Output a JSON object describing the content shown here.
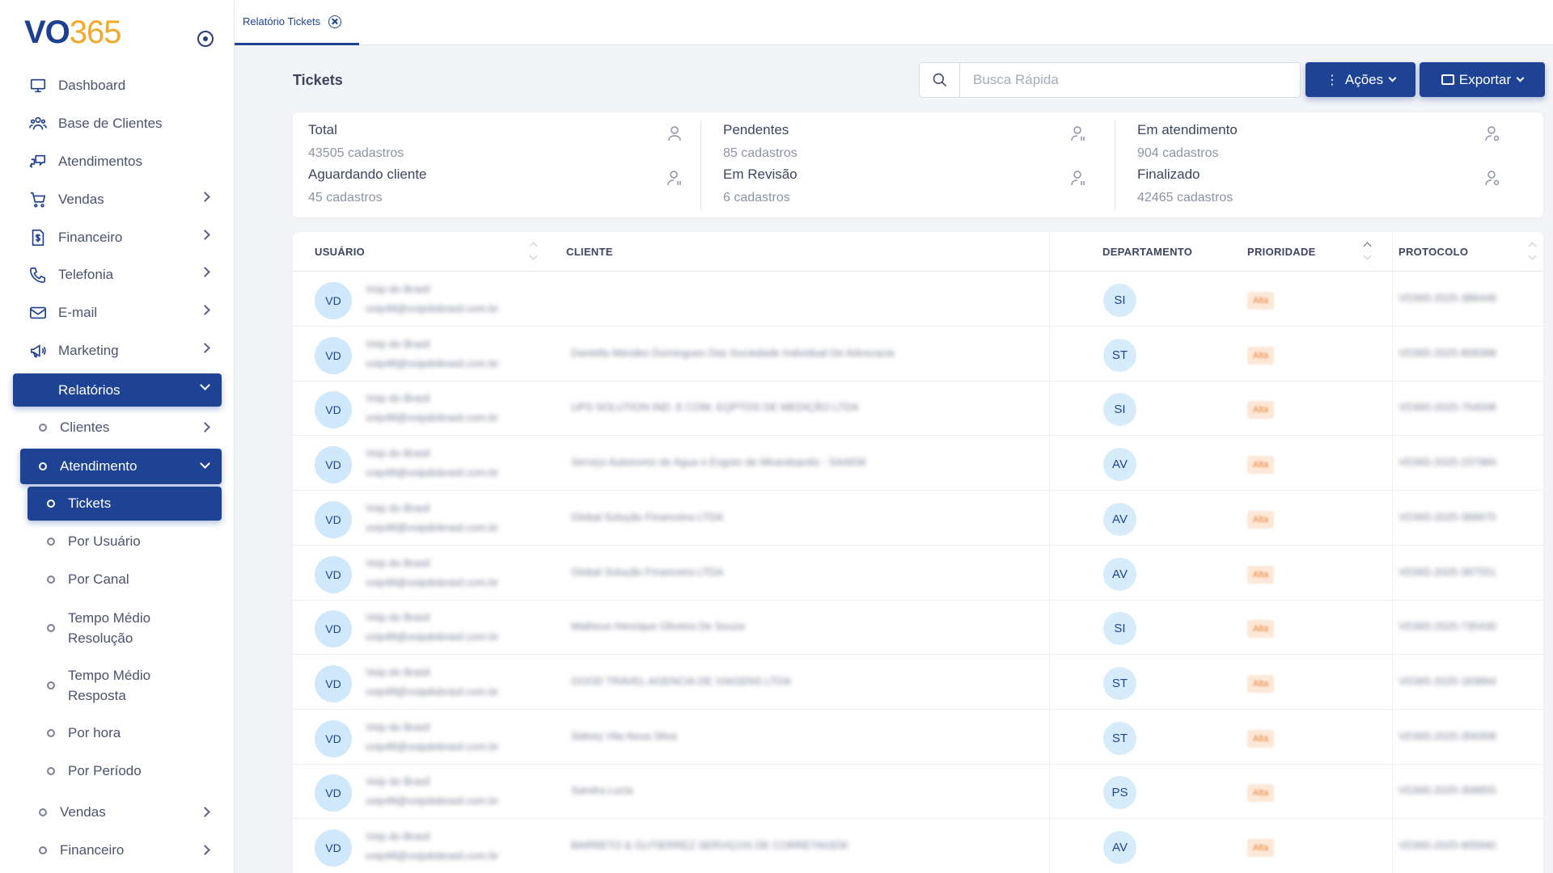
{
  "brand": {
    "logo_a": "VO",
    "logo_b": "365"
  },
  "tab": {
    "label": "Relatório Tickets"
  },
  "sidebar": {
    "items": [
      {
        "label": "Dashboard",
        "icon": "monitor-icon"
      },
      {
        "label": "Base de Clientes",
        "icon": "users-icon"
      },
      {
        "label": "Atendimentos",
        "icon": "chat-icon"
      },
      {
        "label": "Vendas",
        "icon": "cart-icon"
      },
      {
        "label": "Financeiro",
        "icon": "dollar-doc-icon"
      },
      {
        "label": "Telefonia",
        "icon": "phone-icon"
      },
      {
        "label": "E-mail",
        "icon": "mail-icon"
      },
      {
        "label": "Marketing",
        "icon": "megaphone-icon"
      },
      {
        "label": "Relatórios",
        "icon": "none"
      }
    ],
    "sub_items": [
      {
        "label": "Clientes"
      },
      {
        "label": "Atendimento"
      },
      {
        "label": "Tickets"
      },
      {
        "label": "Por Usuário"
      },
      {
        "label": "Por Canal"
      },
      {
        "label": "Tempo Médio Resolução"
      },
      {
        "label": "Tempo Médio Resposta"
      },
      {
        "label": "Por hora"
      },
      {
        "label": "Por Período"
      },
      {
        "label": "Vendas"
      },
      {
        "label": "Financeiro"
      }
    ]
  },
  "header": {
    "title": "Tickets",
    "search_placeholder": "Busca Rápida",
    "acoes_label": "Ações",
    "exportar_label": "Exportar"
  },
  "stats": [
    {
      "label": "Total",
      "value": "43505 cadastros"
    },
    {
      "label": "Pendentes",
      "value": "85 cadastros"
    },
    {
      "label": "Em atendimento",
      "value": "904 cadastros"
    },
    {
      "label": "Aguardando cliente",
      "value": "45 cadastros"
    },
    {
      "label": "Em Revisão",
      "value": "6 cadastros"
    },
    {
      "label": "Finalizado",
      "value": "42465 cadastros"
    }
  ],
  "table": {
    "columns": [
      "USUÁRIO",
      "CLIENTE",
      "DEPARTAMENTO",
      "PRIORIDADE",
      "PROTOCOLO"
    ],
    "rows": [
      {
        "avatar": "VD",
        "user": "Voip do Brasil",
        "email": "voip48@voipdobrasil.com.br",
        "client": "",
        "dept": "SI",
        "priority": "Alta",
        "protocol": "VD365-2025-386448"
      },
      {
        "avatar": "VD",
        "user": "Voip do Brasil",
        "email": "voip48@voipdobrasil.com.br",
        "client": "Daniella Mendes Domingues Das Sociedade Individual De Advocacia",
        "dept": "ST",
        "priority": "Alta",
        "protocol": "VD365-2025-858398"
      },
      {
        "avatar": "VD",
        "user": "Voip do Brasil",
        "email": "voip48@voipdobrasil.com.br",
        "client": "UPS SOLUTION IND. E COM. EQPTOS DE MEDIÇÃO LTDA",
        "dept": "SI",
        "priority": "Alta",
        "protocol": "VD365-2025-754508"
      },
      {
        "avatar": "VD",
        "user": "Voip do Brasil",
        "email": "voip48@voipdobrasil.com.br",
        "client": "Serviço Autonomo de Agua e Esgoto de Mirandopolis - SAAEM",
        "dept": "AV",
        "priority": "Alta",
        "protocol": "VD365-2025-237984"
      },
      {
        "avatar": "VD",
        "user": "Voip do Brasil",
        "email": "voip48@voipdobrasil.com.br",
        "client": "Global Solução Financeira LTDA",
        "dept": "AV",
        "priority": "Alta",
        "protocol": "VD365-2025-368975"
      },
      {
        "avatar": "VD",
        "user": "Voip do Brasil",
        "email": "voip48@voipdobrasil.com.br",
        "client": "Global Solução Financeira LTDA",
        "dept": "AV",
        "priority": "Alta",
        "protocol": "VD365-2025-387551"
      },
      {
        "avatar": "VD",
        "user": "Voip do Brasil",
        "email": "voip48@voipdobrasil.com.br",
        "client": "Matheus Henrique Oliveira De Souza",
        "dept": "SI",
        "priority": "Alta",
        "protocol": "VD365-2025-735430"
      },
      {
        "avatar": "VD",
        "user": "Voip do Brasil",
        "email": "voip48@voipdobrasil.com.br",
        "client": "GOOD TRAVEL AGENCIA DE VIAGENS LTDA",
        "dept": "ST",
        "priority": "Alta",
        "protocol": "VD365-2025-183864"
      },
      {
        "avatar": "VD",
        "user": "Voip do Brasil",
        "email": "voip48@voipdobrasil.com.br",
        "client": "Sidney Vila Nova Silva",
        "dept": "ST",
        "priority": "Alta",
        "protocol": "VD365-2025-356308"
      },
      {
        "avatar": "VD",
        "user": "Voip do Brasil",
        "email": "voip48@voipdobrasil.com.br",
        "client": "Sandra Lucia",
        "dept": "PS",
        "priority": "Alta",
        "protocol": "VD365-2025-308855"
      },
      {
        "avatar": "VD",
        "user": "Voip do Brasil",
        "email": "voip48@voipdobrasil.com.br",
        "client": "BARRETO & GUTIERREZ SERVIÇOS DE CORRETAGEM",
        "dept": "AV",
        "priority": "Alta",
        "protocol": "VD365-2025-905940"
      }
    ]
  },
  "colors": {
    "primary": "#1e4394",
    "accent": "#f0a92a",
    "priority_bg": "#fde7d6",
    "priority_text": "#e8823a"
  }
}
